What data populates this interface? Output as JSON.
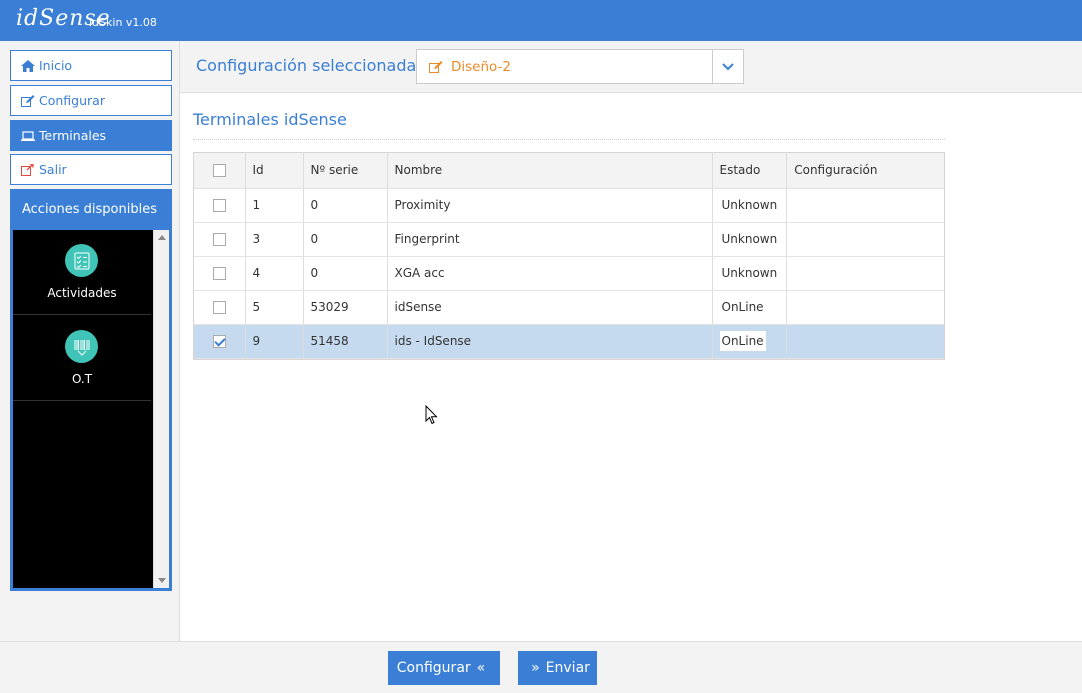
{
  "header": {
    "logo": "idSense",
    "version": "idSkin v1.08"
  },
  "sidebar": {
    "nav": [
      {
        "label": "Inicio",
        "icon": "home-icon"
      },
      {
        "label": "Configurar",
        "icon": "edit-icon"
      },
      {
        "label": "Terminales",
        "icon": "laptop-icon",
        "active": true
      },
      {
        "label": "Salir",
        "icon": "external-link-icon"
      }
    ],
    "actions_title": "Acciones disponibles",
    "actions": [
      {
        "label": "Actividades",
        "icon": "checklist-icon"
      },
      {
        "label": "O.T",
        "icon": "barcode-icon"
      }
    ]
  },
  "config": {
    "label": "Configuración seleccionada:",
    "selected": "Diseño-2"
  },
  "main": {
    "title": "Terminales idSense",
    "columns": [
      "Id",
      "Nº serie",
      "Nombre",
      "Estado",
      "Configuración"
    ],
    "rows": [
      {
        "checked": false,
        "id": "1",
        "serial": "0",
        "name": "Proximity",
        "status": "Unknown",
        "config": ""
      },
      {
        "checked": false,
        "id": "3",
        "serial": "0",
        "name": "Fingerprint",
        "status": "Unknown",
        "config": ""
      },
      {
        "checked": false,
        "id": "4",
        "serial": "0",
        "name": "XGA acc",
        "status": "Unknown",
        "config": ""
      },
      {
        "checked": false,
        "id": "5",
        "serial": "53029",
        "name": "idSense",
        "status": "OnLine",
        "config": ""
      },
      {
        "checked": true,
        "id": "9",
        "serial": "51458",
        "name": "ids - IdSense",
        "status": "OnLine",
        "config": ""
      }
    ]
  },
  "footer": {
    "configurar": "Configurar",
    "enviar": "Enviar"
  },
  "colors": {
    "primary": "#3a7fd5",
    "accent": "#e98b2a",
    "icon_teal": "#40c4b8",
    "selected_row": "#c5d9ef"
  }
}
